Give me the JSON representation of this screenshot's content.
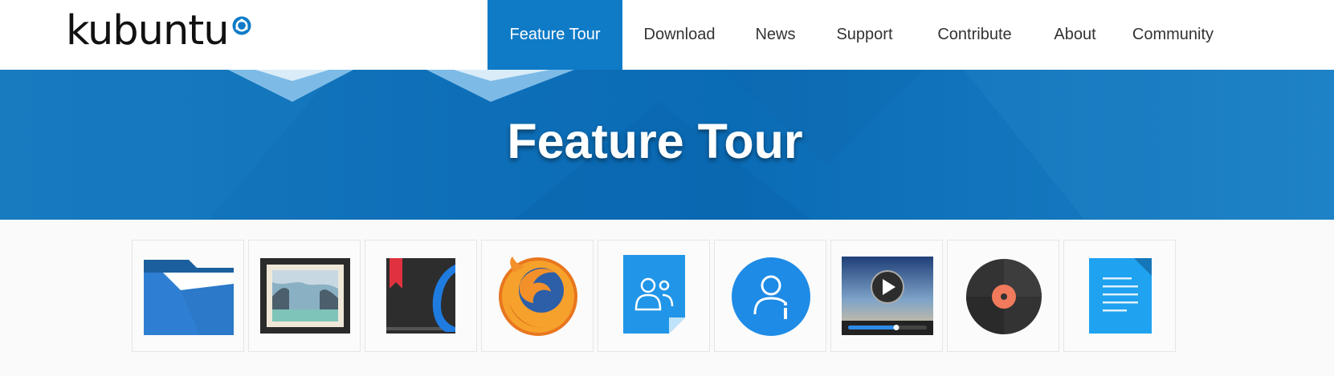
{
  "brand": {
    "name": "kubuntu",
    "logo_icon": "kubuntu-gear-icon",
    "accent": "#0f7bc7"
  },
  "nav": {
    "items": [
      {
        "label": "Feature Tour",
        "active": true
      },
      {
        "label": "Download",
        "active": false
      },
      {
        "label": "News",
        "active": false
      },
      {
        "label": "Support",
        "active": false
      },
      {
        "label": "Contribute",
        "active": false
      },
      {
        "label": "About",
        "active": false
      },
      {
        "label": "Community",
        "active": false
      }
    ]
  },
  "hero": {
    "title": "Feature Tour",
    "background": "#0f6fb8"
  },
  "features": [
    {
      "icon": "folder-icon"
    },
    {
      "icon": "image-viewer-icon"
    },
    {
      "icon": "ebook-reader-icon"
    },
    {
      "icon": "firefox-icon"
    },
    {
      "icon": "contacts-icon"
    },
    {
      "icon": "user-info-icon"
    },
    {
      "icon": "video-player-icon"
    },
    {
      "icon": "music-player-icon"
    },
    {
      "icon": "document-icon"
    }
  ]
}
